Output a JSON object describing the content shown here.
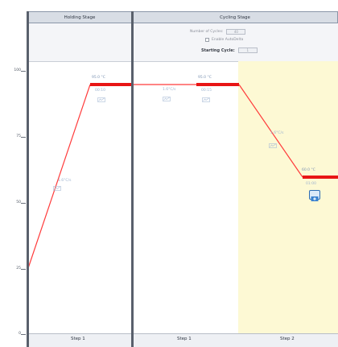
{
  "stages": {
    "holding": {
      "title": "Holding Stage"
    },
    "cycling": {
      "title": "Cycling Stage",
      "number_of_cycles_label": "Number of Cycles:",
      "number_of_cycles_value": "40",
      "enable_autodelta_label": "Enable AutoDelta",
      "starting_cycle_label": "Starting Cycle:",
      "starting_cycle_value": "1"
    }
  },
  "y_axis": {
    "ticks": [
      "100",
      "75",
      "50",
      "25",
      "0"
    ]
  },
  "steps": [
    {
      "label": "Step 1"
    },
    {
      "label": "Step 1"
    },
    {
      "label": "Step 2"
    }
  ],
  "points": [
    {
      "ramp": "1.6°C/s",
      "temp": "95.0 °C",
      "time": "00:10"
    },
    {
      "ramp": "1.6°C/s",
      "temp": "95.0 °C",
      "time": "00:15"
    },
    {
      "ramp": "1.6°C/s",
      "temp": "60.0 °C",
      "time": "01:00"
    }
  ],
  "colors": {
    "line": "#ff3b3b",
    "hold": "#e81515",
    "highlight": "#fdf9d4"
  }
}
